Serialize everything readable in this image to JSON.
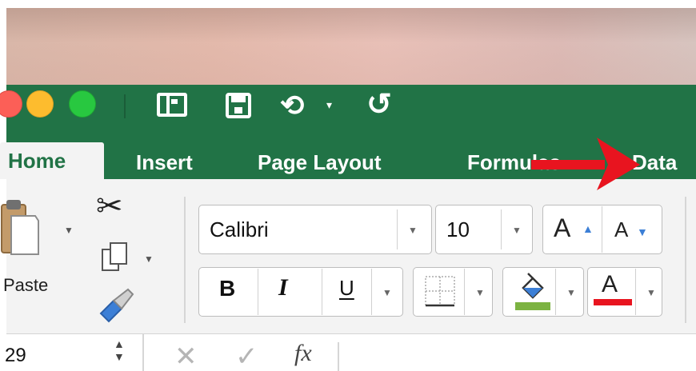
{
  "title_bar": {
    "window_controls": [
      "close",
      "minimize",
      "zoom"
    ],
    "quick_access": [
      "sidebar-icon",
      "save-icon",
      "undo-icon",
      "redo-icon"
    ],
    "undo_dropdown_glyph": "▾"
  },
  "tabs": [
    {
      "label": "Home",
      "active": true
    },
    {
      "label": "Insert"
    },
    {
      "label": "Page Layout"
    },
    {
      "label": "Formulas"
    },
    {
      "label": "Data"
    }
  ],
  "ribbon": {
    "clipboard": {
      "paste_label": "Paste",
      "cut_glyph": "✂"
    },
    "font": {
      "name": "Calibri",
      "size": "10",
      "grow_label": "A",
      "shrink_label": "A",
      "bold_label": "B",
      "italic_label": "I",
      "underline_label": "U",
      "font_color_label": "A",
      "fill_color": "#7cb342",
      "font_color": "#e8141f"
    }
  },
  "formula_bar": {
    "name_box": "29",
    "cancel_glyph": "✕",
    "enter_glyph": "✓",
    "fx_label": "fx"
  },
  "colors": {
    "accent": "#217346",
    "annotation_arrow": "#e8141f"
  }
}
